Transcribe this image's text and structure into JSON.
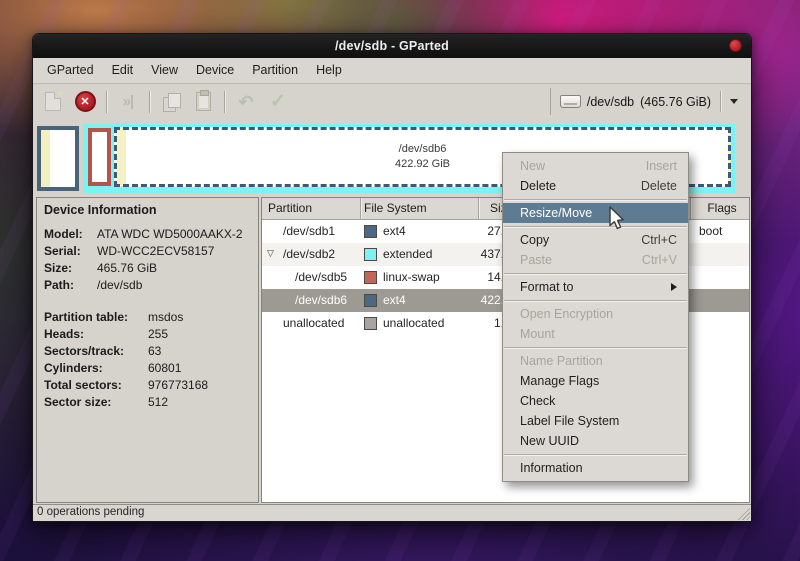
{
  "window": {
    "title": "/dev/sdb - GParted"
  },
  "menubar": {
    "items": [
      "GParted",
      "Edit",
      "View",
      "Device",
      "Partition",
      "Help"
    ]
  },
  "toolbar": {
    "icons": [
      {
        "name": "new-partition-icon",
        "glyph": "",
        "enabled": false
      },
      {
        "name": "delete-partition-icon",
        "glyph": "✕",
        "enabled": true
      },
      {
        "name": "resize-move-icon",
        "glyph": "»|",
        "enabled": false
      },
      {
        "name": "copy-icon",
        "glyph": "",
        "enabled": false
      },
      {
        "name": "paste-icon",
        "glyph": "",
        "enabled": false
      },
      {
        "name": "undo-icon",
        "glyph": "↶",
        "enabled": false
      },
      {
        "name": "apply-icon",
        "glyph": "✓",
        "enabled": false
      }
    ],
    "device_selector": {
      "device": "/dev/sdb",
      "size": "(465.76 GiB)"
    }
  },
  "partition_bar": {
    "selected_label": "/dev/sdb6",
    "selected_size": "422.92 GiB"
  },
  "device_info": {
    "title": "Device Information",
    "fields_primary": [
      {
        "label": "Model:",
        "value": "ATA WDC WD5000AAKX-2"
      },
      {
        "label": "Serial:",
        "value": "WD-WCC2ECV58157"
      },
      {
        "label": "Size:",
        "value": "465.76 GiB"
      },
      {
        "label": "Path:",
        "value": "/dev/sdb"
      }
    ],
    "fields_secondary": [
      {
        "label": "Partition table:",
        "value": "msdos"
      },
      {
        "label": "Heads:",
        "value": "255"
      },
      {
        "label": "Sectors/track:",
        "value": "63"
      },
      {
        "label": "Cylinders:",
        "value": "60801"
      },
      {
        "label": "Total sectors:",
        "value": "976773168"
      },
      {
        "label": "Sector size:",
        "value": "512"
      }
    ]
  },
  "partition_table": {
    "columns": [
      "Partition",
      "File System",
      "Size",
      "Flags"
    ],
    "rows": [
      {
        "expander": "",
        "name": "/dev/sdb1",
        "fs": "ext4",
        "color": "#4b6983",
        "size": "27.",
        "flags": "boot"
      },
      {
        "expander": "▽",
        "name": "/dev/sdb2",
        "fs": "extended",
        "color": "#7df2f2",
        "size": "437.",
        "flags": ""
      },
      {
        "expander": "",
        "name": "/dev/sdb5",
        "fs": "linux-swap",
        "color": "#c1665a",
        "size": "14.",
        "flags": ""
      },
      {
        "expander": "",
        "name": "/dev/sdb6",
        "fs": "ext4",
        "color": "#4b6983",
        "size": "422.",
        "flags": ""
      },
      {
        "expander": "",
        "name": "unallocated",
        "fs": "unallocated",
        "color": "#a8a5a0",
        "size": "1.",
        "flags": ""
      }
    ]
  },
  "context_menu": {
    "items": [
      {
        "label": "New",
        "shortcut": "Insert"
      },
      {
        "label": "Delete",
        "shortcut": "Delete"
      },
      {
        "label": "Resize/Move",
        "shortcut": ""
      },
      {
        "label": "Copy",
        "shortcut": "Ctrl+C"
      },
      {
        "label": "Paste",
        "shortcut": "Ctrl+V"
      },
      {
        "label": "Format to",
        "shortcut": ""
      },
      {
        "label": "Open Encryption",
        "shortcut": ""
      },
      {
        "label": "Mount",
        "shortcut": ""
      },
      {
        "label": "Name Partition",
        "shortcut": ""
      },
      {
        "label": "Manage Flags",
        "shortcut": ""
      },
      {
        "label": "Check",
        "shortcut": ""
      },
      {
        "label": "Label File System",
        "shortcut": ""
      },
      {
        "label": "New UUID",
        "shortcut": ""
      },
      {
        "label": "Information",
        "shortcut": ""
      }
    ]
  },
  "status_bar": {
    "text": "0 operations pending"
  },
  "colors": {
    "menu_highlight": "#5d7c93",
    "ext4_swatch": "#4b6983",
    "swap_swatch": "#c1665a",
    "extended_swatch": "#7df2f2",
    "unallocated_swatch": "#a8a5a0",
    "close_button": "#c0272d"
  }
}
